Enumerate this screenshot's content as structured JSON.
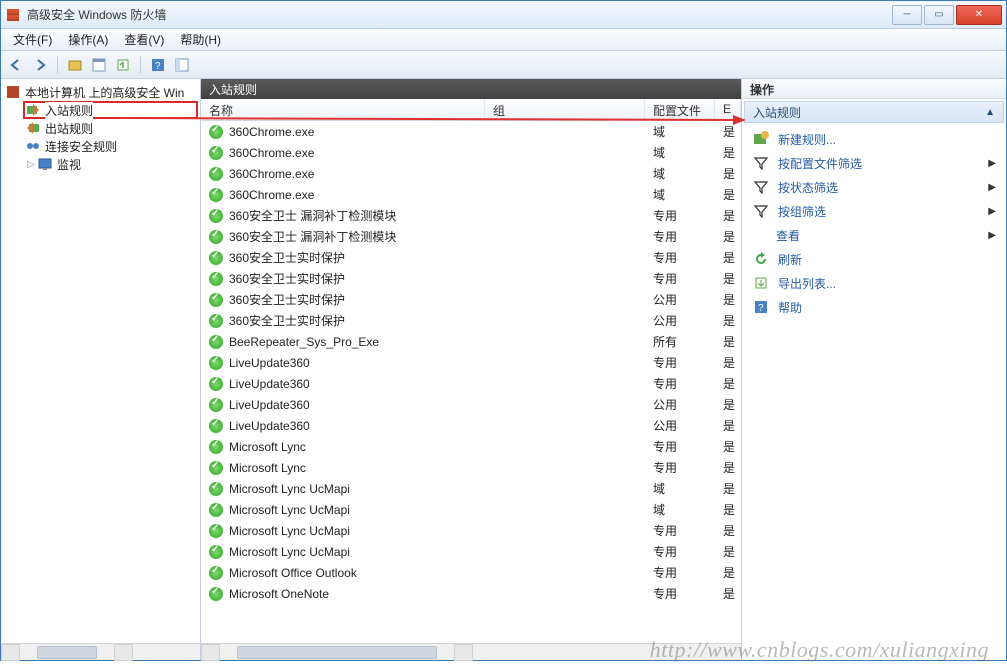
{
  "window": {
    "title": "高级安全 Windows 防火墙"
  },
  "menu": {
    "file": "文件(F)",
    "action": "操作(A)",
    "view": "查看(V)",
    "help": "帮助(H)"
  },
  "tree": {
    "root": "本地计算机 上的高级安全 Win",
    "inbound": "入站规则",
    "outbound": "出站规则",
    "connsec": "连接安全规则",
    "monitor": "监视"
  },
  "list": {
    "title": "入站规则",
    "cols": {
      "name": "名称",
      "group": "组",
      "profile": "配置文件",
      "e": "E"
    },
    "rows": [
      {
        "name": "360Chrome.exe",
        "group": "",
        "profile": "域",
        "e": "是"
      },
      {
        "name": "360Chrome.exe",
        "group": "",
        "profile": "域",
        "e": "是"
      },
      {
        "name": "360Chrome.exe",
        "group": "",
        "profile": "域",
        "e": "是"
      },
      {
        "name": "360Chrome.exe",
        "group": "",
        "profile": "域",
        "e": "是"
      },
      {
        "name": "360安全卫士 漏洞补丁检测模块",
        "group": "",
        "profile": "专用",
        "e": "是"
      },
      {
        "name": "360安全卫士 漏洞补丁检测模块",
        "group": "",
        "profile": "专用",
        "e": "是"
      },
      {
        "name": "360安全卫士实时保护",
        "group": "",
        "profile": "专用",
        "e": "是"
      },
      {
        "name": "360安全卫士实时保护",
        "group": "",
        "profile": "专用",
        "e": "是"
      },
      {
        "name": "360安全卫士实时保护",
        "group": "",
        "profile": "公用",
        "e": "是"
      },
      {
        "name": "360安全卫士实时保护",
        "group": "",
        "profile": "公用",
        "e": "是"
      },
      {
        "name": "BeeRepeater_Sys_Pro_Exe",
        "group": "",
        "profile": "所有",
        "e": "是"
      },
      {
        "name": "LiveUpdate360",
        "group": "",
        "profile": "专用",
        "e": "是"
      },
      {
        "name": "LiveUpdate360",
        "group": "",
        "profile": "专用",
        "e": "是"
      },
      {
        "name": "LiveUpdate360",
        "group": "",
        "profile": "公用",
        "e": "是"
      },
      {
        "name": "LiveUpdate360",
        "group": "",
        "profile": "公用",
        "e": "是"
      },
      {
        "name": "Microsoft Lync",
        "group": "",
        "profile": "专用",
        "e": "是"
      },
      {
        "name": "Microsoft Lync",
        "group": "",
        "profile": "专用",
        "e": "是"
      },
      {
        "name": "Microsoft Lync UcMapi",
        "group": "",
        "profile": "域",
        "e": "是"
      },
      {
        "name": "Microsoft Lync UcMapi",
        "group": "",
        "profile": "域",
        "e": "是"
      },
      {
        "name": "Microsoft Lync UcMapi",
        "group": "",
        "profile": "专用",
        "e": "是"
      },
      {
        "name": "Microsoft Lync UcMapi",
        "group": "",
        "profile": "专用",
        "e": "是"
      },
      {
        "name": "Microsoft Office Outlook",
        "group": "",
        "profile": "专用",
        "e": "是"
      },
      {
        "name": "Microsoft OneNote",
        "group": "",
        "profile": "专用",
        "e": "是"
      }
    ]
  },
  "actions": {
    "header": "操作",
    "group_title": "入站规则",
    "new_rule": "新建规则...",
    "filter_profile": "按配置文件筛选",
    "filter_state": "按状态筛选",
    "filter_group": "按组筛选",
    "view": "查看",
    "refresh": "刷新",
    "export": "导出列表...",
    "help": "帮助"
  },
  "watermark": "http://www.cnblogs.com/xuliangxing"
}
